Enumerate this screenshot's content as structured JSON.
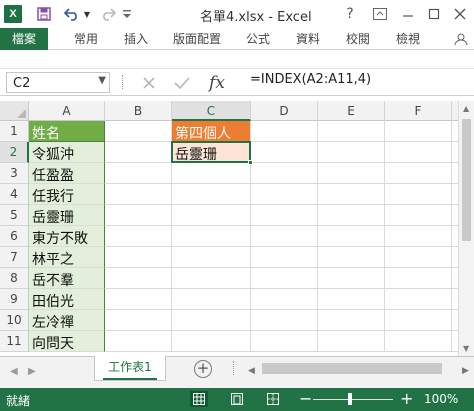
{
  "titlebar": {
    "logo": "X",
    "title": "名單4.xlsx - Excel",
    "help": "?",
    "icons": [
      "save-icon",
      "undo-icon",
      "redo-icon",
      "customize-icon"
    ]
  },
  "ribbon": {
    "tabs": [
      "檔案",
      "常用",
      "插入",
      "版面配置",
      "公式",
      "資料",
      "校閱",
      "檢視"
    ]
  },
  "formula_bar": {
    "name_box": "C2",
    "fx": "fx",
    "formula": "=INDEX(A2:A11,4)"
  },
  "columns": [
    "A",
    "B",
    "C",
    "D",
    "E",
    "F"
  ],
  "rows": [
    "1",
    "2",
    "3",
    "4",
    "5",
    "6",
    "7",
    "8",
    "9",
    "10",
    "11"
  ],
  "cells": {
    "A": [
      "姓名",
      "令狐沖",
      "任盈盈",
      "任我行",
      "岳靈珊",
      "東方不敗",
      "林平之",
      "岳不羣",
      "田伯光",
      "左冷禪",
      "向問天"
    ],
    "C1": "第四個人",
    "C2": "岳靈珊"
  },
  "colors": {
    "accent": "#217346",
    "header_fill": "#70ad47",
    "name_fill": "#e2efda",
    "label_fill": "#ed7d31",
    "result_fill": "#fce4d6"
  },
  "sheets": {
    "active": "工作表1",
    "add": "+"
  },
  "status": {
    "ready": "就緒",
    "zoom": "100%"
  }
}
